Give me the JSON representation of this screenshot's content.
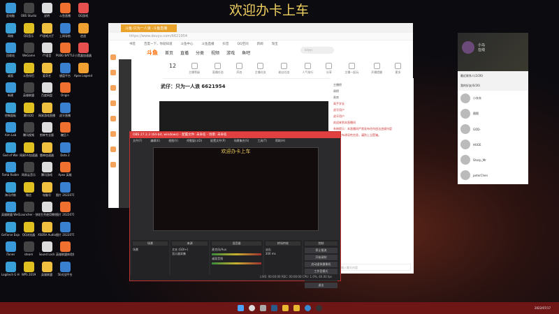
{
  "desktop": {
    "banner": "欢迎办卡上车",
    "icons": [
      "此电脑",
      "OBS Studio",
      "说明",
      "斗鱼直播",
      "QQ游戏",
      "网络",
      "QQ音乐",
      "YY游戏大厅",
      "上网导航",
      "逆战",
      "回收站",
      "WeGame",
      "YY语音",
      "PUBG BATTLEGR...",
      "小黑盒加速器",
      "桌面",
      "斗鱼伴侣",
      "爱奇艺",
      "键盘平台",
      "Apex Legends",
      "新建",
      "英雄联盟",
      "百度网盘",
      "Origin",
      "",
      "控制面板",
      "腾讯QQ",
      "网易游戏直播",
      "虎牙直播",
      "",
      "Aim Lab",
      "腾讯视频",
      "剪映专业版",
      "糖豆人",
      "",
      "God of War",
      "网易UU加速器",
      "雷神加速器",
      "Dota 2",
      "",
      "Tomb Raider",
      "网易云音乐",
      "腾讯游戏",
      "Apex 英雄",
      "",
      "海马代练",
      "微信",
      "电脑号",
      "图片 2022071...",
      "",
      "英雄联盟 WeGame版",
      "Launcher - 快捷方式",
      "花生壳使用教程",
      "图片 2022071...",
      "",
      "GeForce Experience",
      "QQ浏览器",
      "XSERA Audio",
      "图片 2022071...",
      "",
      "iTunes",
      "steam",
      "Sound Lock",
      "英雄联盟体验服平台",
      "",
      "Logitech G HUB",
      "WPS 2019",
      "英雄联盟",
      "5E对战平台",
      ""
    ]
  },
  "browser": {
    "tab": "斗鱼-只为一人浪 -斗鱼直播",
    "address": "https://www.douyu.com/6621954",
    "bookmarks": [
      "书签",
      "百度一下，你就知道",
      "斗鱼中心",
      "斗鱼直播",
      "抖音",
      "QQ空间",
      "新闻",
      "淘宝"
    ],
    "logo": "斗鱼",
    "nav": [
      "首页",
      "直播",
      "分类",
      "视频",
      "游戏",
      "鱼吧"
    ],
    "search_placeholder": "lolyyc",
    "tools": [
      "主播等级",
      "直播任务",
      "声浪",
      "主播任务",
      "粉丝任务",
      "人气排行",
      "分享",
      "主播一起玩",
      "开播提醒",
      "更多"
    ],
    "level": "12",
    "room_title": "武仔：只为一人浪 6621954",
    "chat_lines": [
      "主播榜",
      "周榜",
      "贵宾",
      "高手学长",
      "虎牙用户",
      "虎牙用户",
      "欢迎来到本直播间",
      "系统提示：本直播间严禁发布任何违法违规内容",
      "请勿发布诱导性信息，谨防上当受骗。"
    ],
    "chat_placeholder": "这里输入聊天内容"
  },
  "qq": {
    "name": "小马",
    "status": "在线",
    "groups": [
      "最近联系人(2/26)",
      "我的好友(6/26)"
    ],
    "contacts": [
      "小灰灰",
      "图图",
      "GOD-",
      "HUGE",
      "Sharp_Mr",
      "peterChen"
    ]
  },
  "obs": {
    "title": "OBS 27.2.3 (64-bit, windows) - 配置文件: 未命名 - 场景: 未命名",
    "menu": [
      "文件(F)",
      "编辑(E)",
      "视图(V)",
      "停靠窗口(D)",
      "配置文件(P)",
      "场景集合(S)",
      "工具(T)",
      "帮助(H)"
    ],
    "preview_banner": "欢迎办卡上车",
    "docks": {
      "scenes": "场景",
      "scene_item": "场景",
      "sources": "来源",
      "source_items": [
        "文本 (GDI+)",
        "显示器采集"
      ],
      "mixer": "混音器",
      "mixer_items": [
        "麦克风/Aux",
        "桌面音频"
      ],
      "transitions": "转场特效",
      "transition": "淡出",
      "duration": "300 ms",
      "controls": "控制",
      "buttons": [
        "停止推流",
        "开始录制",
        "启动虚拟摄像机",
        "工作室模式",
        "设置",
        "退出"
      ]
    },
    "status": "LIVE: 00:00:00  REC: 00:00:00  CPU: 1.0%, 60.00 fps"
  },
  "taskbar": {
    "clock": "2022/07/17"
  }
}
